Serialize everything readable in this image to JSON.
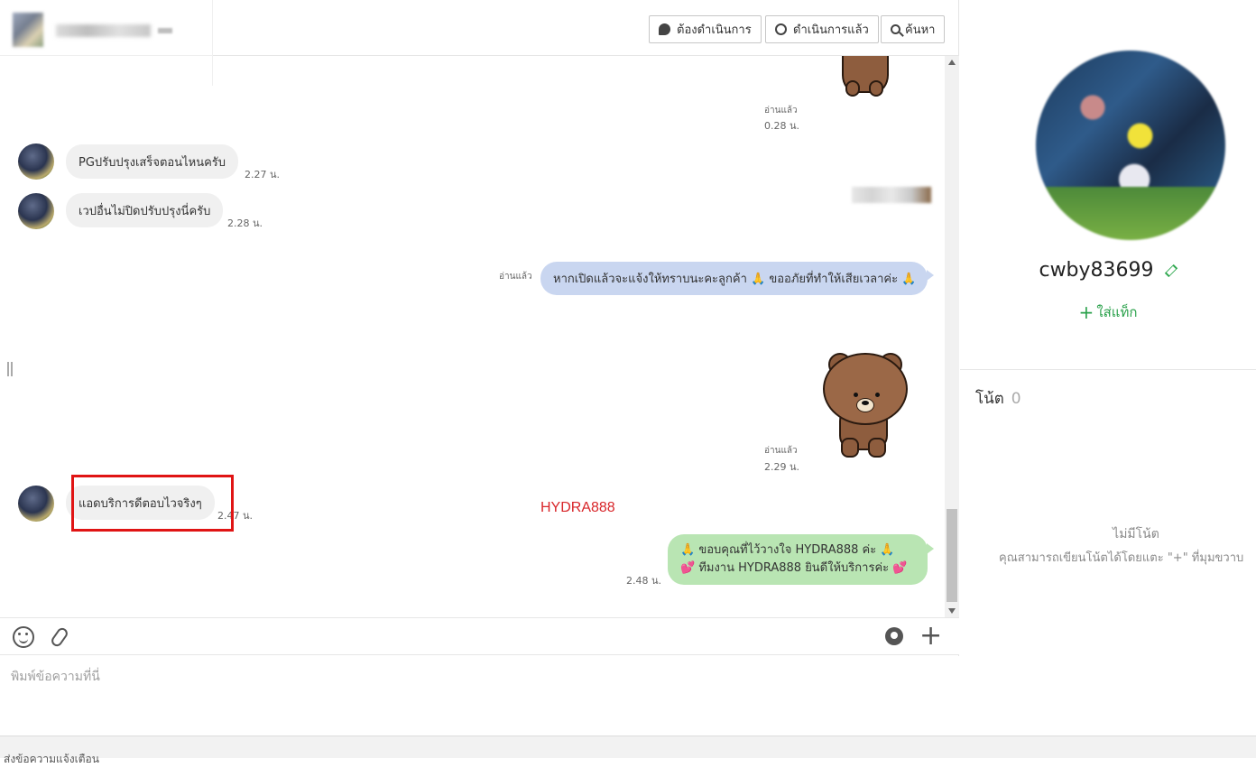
{
  "header": {
    "buttons": {
      "todo": "ต้องดำเนินการ",
      "done": "ดำเนินการแล้ว",
      "search": "ค้นหา"
    }
  },
  "messages": [
    {
      "id": "m1",
      "dir": "out",
      "type": "sticker",
      "read": "อ่านแล้ว",
      "time": "0.28 น."
    },
    {
      "id": "m2",
      "dir": "in",
      "text": "PGปรับปรุงเสร็จตอนไหนครับ",
      "time": "2.27 น."
    },
    {
      "id": "m3",
      "dir": "in",
      "text": "เวปอื่นไม่ปิดปรับปรุงนี่ครับ",
      "time": "2.28 น."
    },
    {
      "id": "m4",
      "dir": "out",
      "text": "หากเปิดแล้วจะแจ้งให้ทราบนะคะลูกค้า 🙏 ขออภัยที่ทำให้เสียเวลาค่ะ 🙏",
      "read": "อ่านแล้ว"
    },
    {
      "id": "m5",
      "dir": "out",
      "type": "sticker",
      "read": "อ่านแล้ว",
      "time": "2.29 น."
    },
    {
      "id": "m6",
      "dir": "in",
      "text": "แอดบริการดีตอบไวจริงๆ",
      "time": "2.47 น."
    },
    {
      "id": "m7",
      "dir": "out",
      "line1": "🙏 ขอบคุณที่ไว้วางใจ HYDRA888 ค่ะ 🙏",
      "line2": "💕 ทีมงาน HYDRA888 ยินดีให้บริการค่ะ 💕",
      "time": "2.48 น."
    }
  ],
  "watermark": "HYDRA888",
  "composer": {
    "placeholder": "พิมพ์ข้อความที่นี่",
    "icons": [
      "smile-icon",
      "attach-icon",
      "voom-icon",
      "plus-icon"
    ]
  },
  "footer": {
    "text": "ส่งข้อความแจ้งเตือน"
  },
  "profile": {
    "name": "cwby83699",
    "add_tag": "ใส่แท็ก",
    "notes_label": "โน้ต",
    "notes_count": "0",
    "no_notes": "ไม่มีโน้ต",
    "notes_hint": "คุณสามารถเขียนโน้ตได้โดยแตะ \"+\" ที่มุมขวาบ"
  },
  "colors": {
    "accent_green": "#2aa14b",
    "bubble_blue": "#c9d6f0",
    "bubble_green": "#b9e5b3",
    "highlight_red": "#e01414"
  }
}
